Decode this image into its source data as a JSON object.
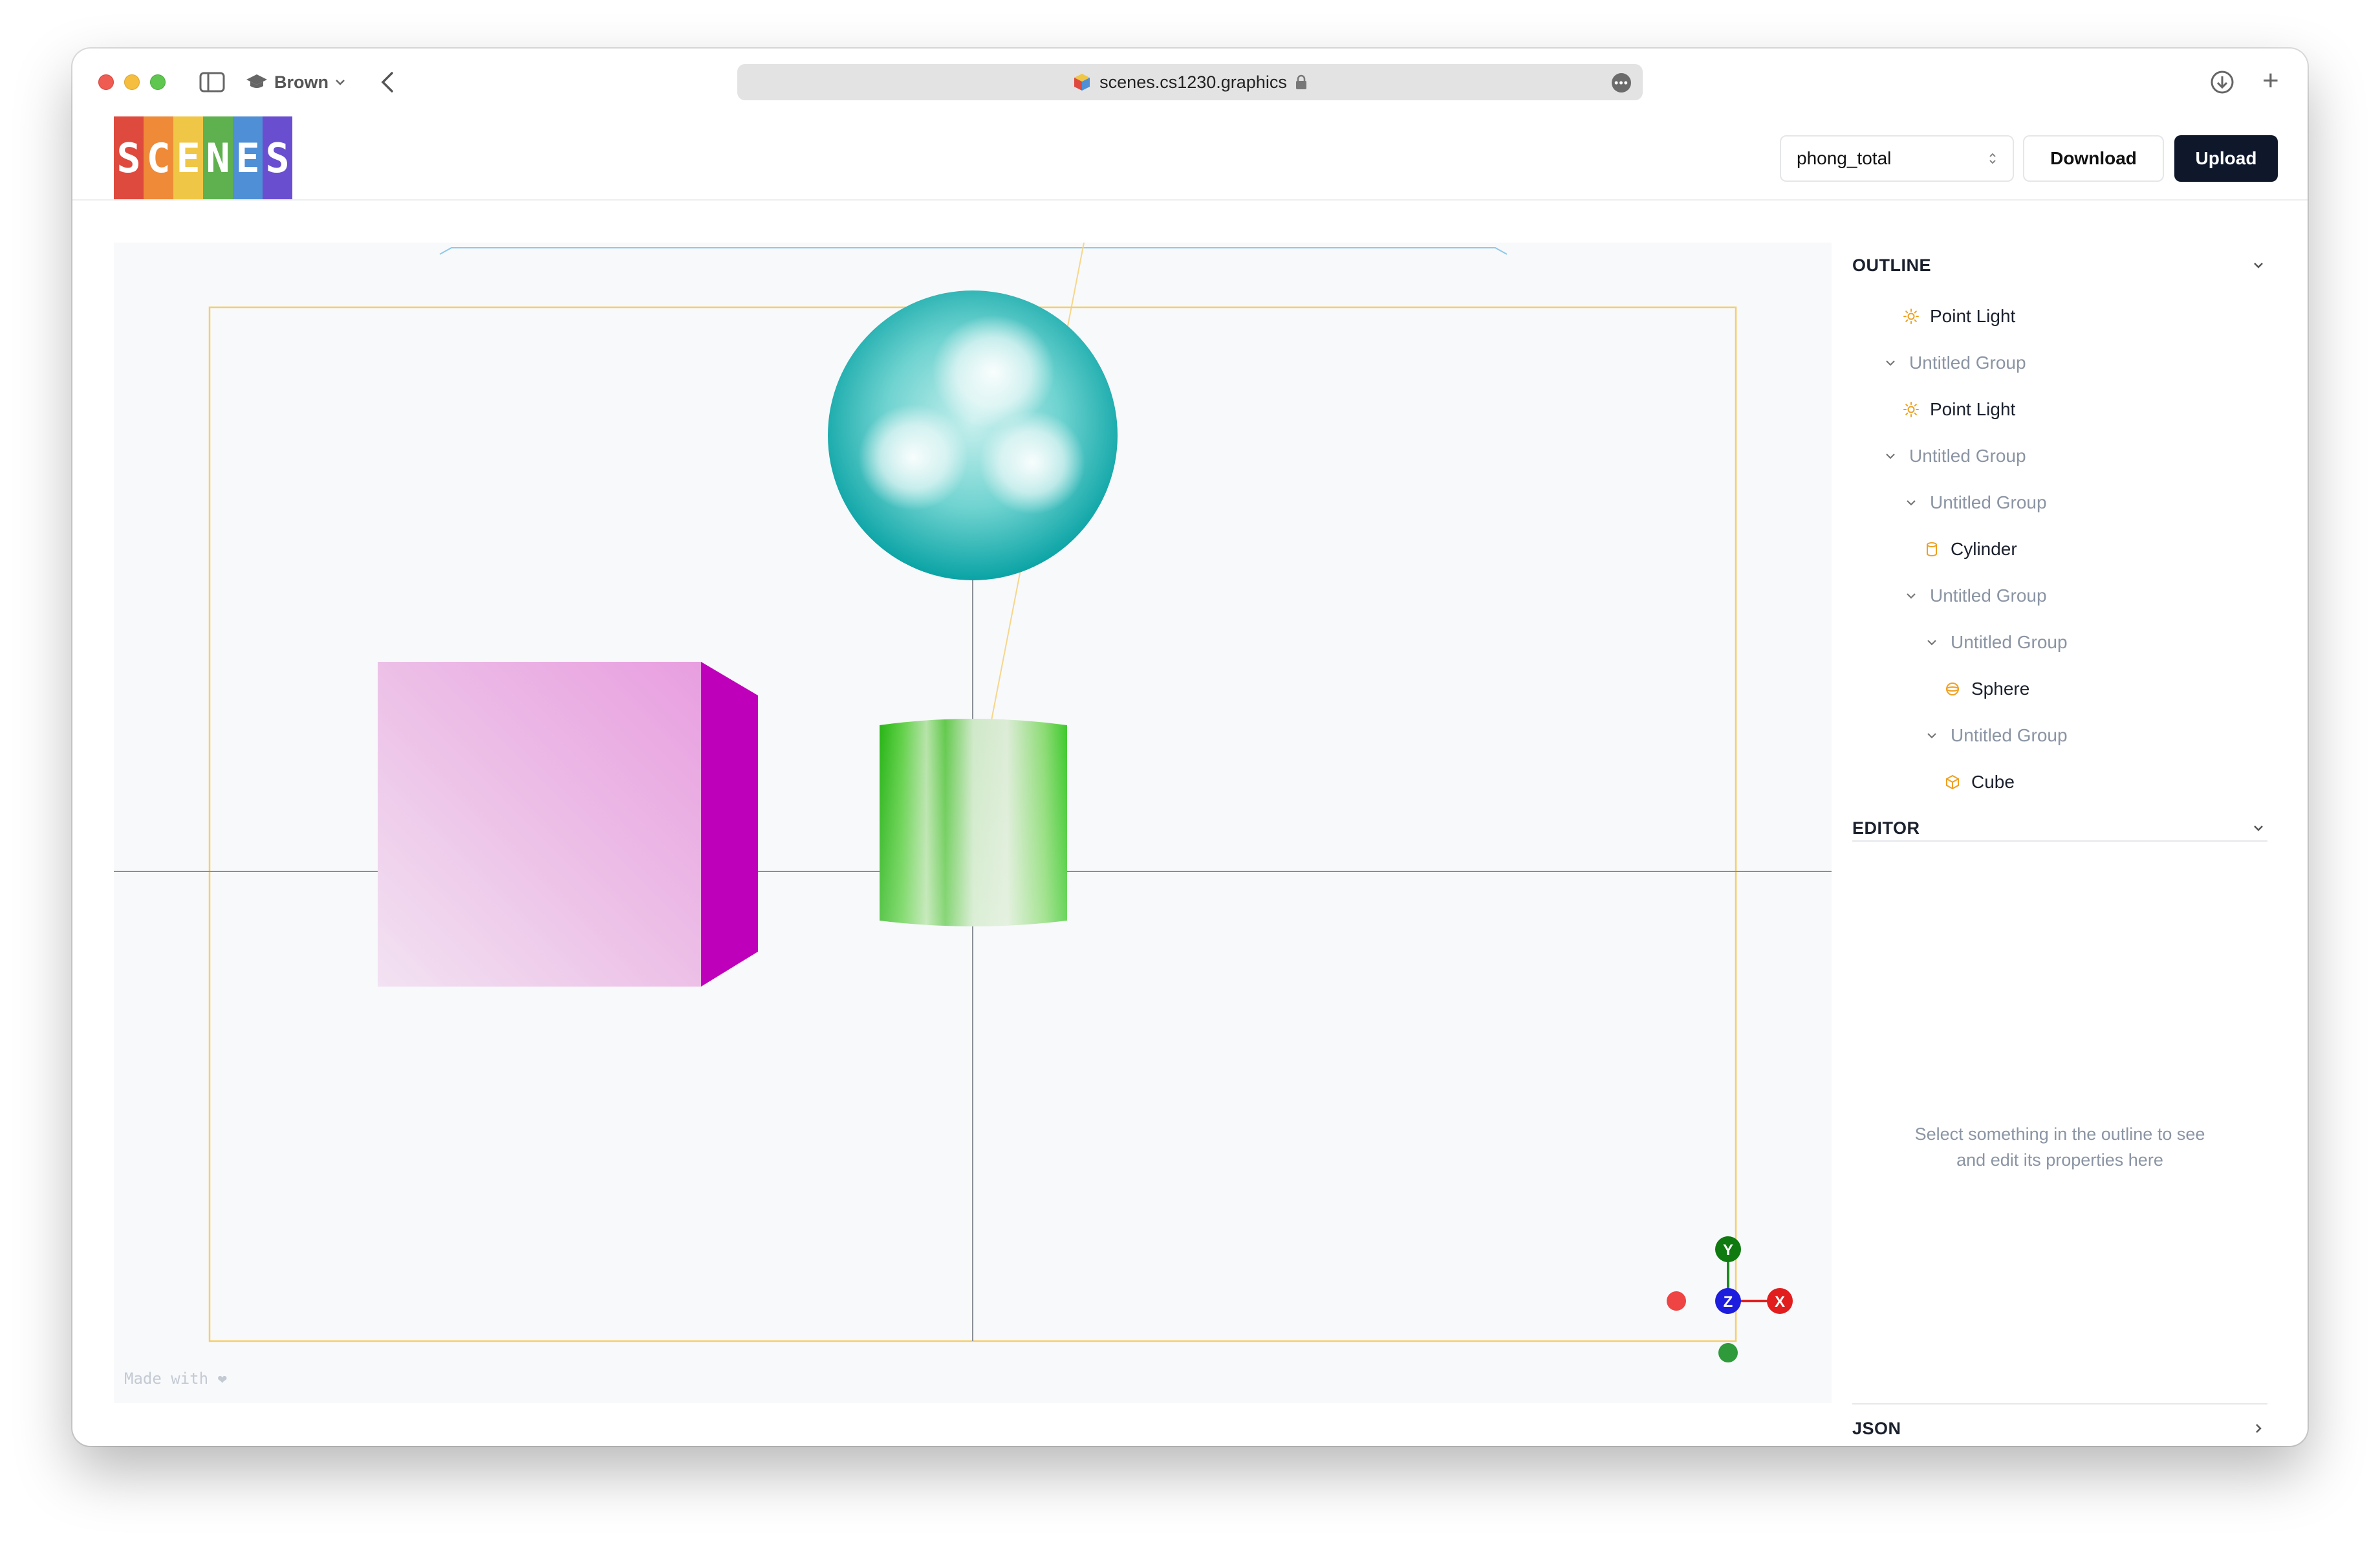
{
  "browser": {
    "profile": "Brown",
    "url": "scenes.cs1230.graphics"
  },
  "app": {
    "logo_letters": [
      "S",
      "C",
      "E",
      "N",
      "E",
      "S"
    ],
    "logo_colors": [
      "#de4a3e",
      "#ee8a38",
      "#f0c646",
      "#5fb04e",
      "#4f8fd6",
      "#6a4ed0"
    ],
    "scene_select": "phong_total",
    "download_label": "Download",
    "upload_label": "Upload"
  },
  "viewport": {
    "made_with": "Made with ❤",
    "gizmo": {
      "y": "Y",
      "z": "Z",
      "x": "X"
    }
  },
  "outline": {
    "title": "OUTLINE",
    "items": [
      {
        "label": "Point Light",
        "kind": "light"
      },
      {
        "label": "Untitled Group",
        "kind": "group"
      },
      {
        "label": "Point Light",
        "kind": "light"
      },
      {
        "label": "Untitled Group",
        "kind": "group"
      },
      {
        "label": "Untitled Group",
        "kind": "group"
      },
      {
        "label": "Cylinder",
        "kind": "cylinder"
      },
      {
        "label": "Untitled Group",
        "kind": "group"
      },
      {
        "label": "Untitled Group",
        "kind": "group"
      },
      {
        "label": "Sphere",
        "kind": "sphere"
      },
      {
        "label": "Untitled Group",
        "kind": "group"
      },
      {
        "label": "Cube",
        "kind": "cube"
      }
    ]
  },
  "editor": {
    "title": "EDITOR",
    "empty_line1": "Select something in the outline to see",
    "empty_line2": "and edit its properties here"
  },
  "json_section": {
    "title": "JSON"
  },
  "colors": {
    "accent_dark": "#0f172a",
    "icon_orange": "#f0a020",
    "sphere": "#2fb8b8",
    "cube": "#e07ad8",
    "cube_side": "#bf00bb",
    "cylinder": "#3cc82a"
  }
}
